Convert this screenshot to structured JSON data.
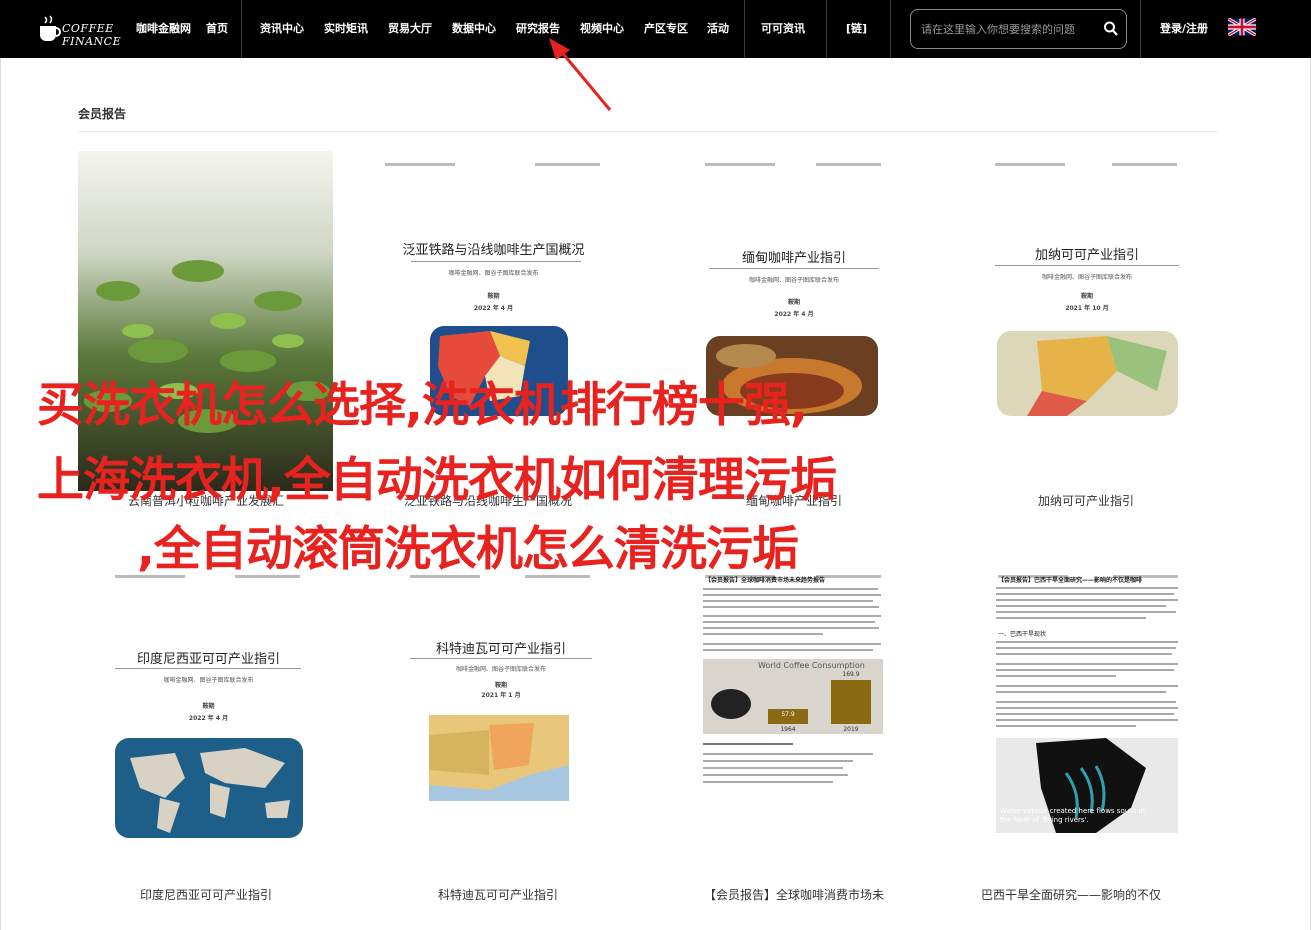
{
  "nav": {
    "logo_line1": "COFFEE",
    "logo_line2": "FINANCE",
    "brand": "咖啡金融网",
    "items": [
      "首页",
      "资讯中心",
      "实时矩讯",
      "贸易大厅",
      "数据中心",
      "研究报告",
      "视频中心",
      "产区专区",
      "活动",
      "可可资讯",
      "[链]"
    ],
    "search_placeholder": "请在这里输入你想要搜索的问题",
    "login": "登录/注册"
  },
  "section": {
    "title": "会员报告"
  },
  "cards": [
    {
      "title": "",
      "caption": "云南普洱小粒咖啡产业发展汇"
    },
    {
      "title": "泛亚铁路与沿线咖啡生产国概况",
      "sub": "咖啡金融网、图谷子图库联合发布",
      "date1": "鞍期",
      "date2": "2022 年 4 月",
      "caption": "泛亚铁路与沿线咖啡生产国概况"
    },
    {
      "title": "缅甸咖啡产业指引",
      "sub": "咖啡金融网、图谷子图库联合发布",
      "date1": "鞍期",
      "date2": "2022 年 4 月",
      "caption": "缅甸咖啡产业指引"
    },
    {
      "title": "加纳可可产业指引",
      "sub": "咖啡金融网、图谷子图库联合发布",
      "date1": "鞍期",
      "date2": "2021 年 10 月",
      "caption": "加纳可可产业指引"
    },
    {
      "title": "印度尼西亚可可产业指引",
      "sub": "咖啡金融网、图谷子图库联合发布",
      "date1": "鞍期",
      "date2": "2022 年 4 月",
      "caption": "印度尼西亚可可产业指引"
    },
    {
      "title": "科特迪瓦可可产业指引",
      "sub": "咖啡金融网、图谷子图库联合发布",
      "date1": "鞍期",
      "date2": "2021 年 1 月",
      "caption": "科特迪瓦可可产业指引"
    },
    {
      "title": "【会员报告】全球咖啡消费市场未来趋势报告",
      "chart_title": "World Coffee Consumption",
      "chart_labels": [
        "1964",
        "2019"
      ],
      "chart_values": [
        57.9,
        169.9
      ],
      "caption": "【会员报告】全球咖啡消费市场未"
    },
    {
      "title": "【会员报告】巴西干旱全面研究——影响的不仅是咖啡",
      "section_head": "一、巴西干旱现状",
      "img_caption": "Water vapour created here flows south in the form of 'flying rivers'.",
      "caption": "巴西干旱全面研究——影响的不仅"
    }
  ],
  "overlay": {
    "line1": "买洗衣机怎么选择,洗衣机排行榜十强,",
    "line2": "上海洗衣机,全自动洗衣机如何清理污垢",
    "line3": ",全自动滚筒洗衣机怎么清洗污垢"
  },
  "colors": {
    "overlay": "#e8231f",
    "nav_bg": "#000000"
  }
}
